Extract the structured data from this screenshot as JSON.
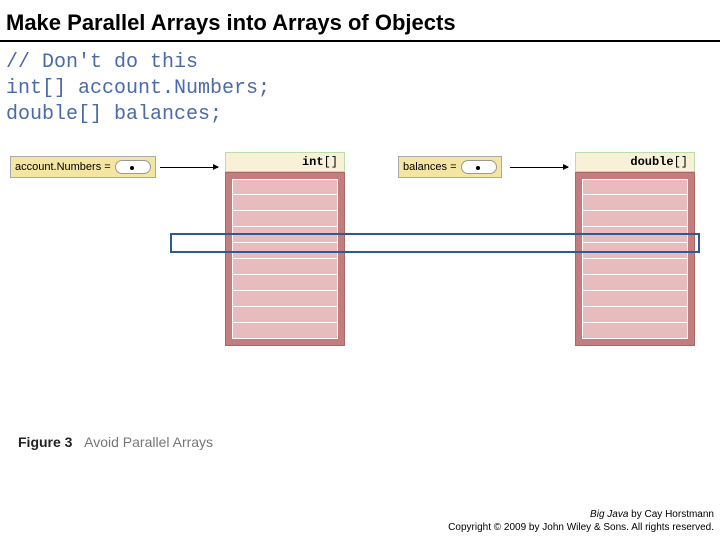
{
  "title": "Make Parallel Arrays into Arrays of Objects",
  "code": {
    "line1": "// Don't do this",
    "line2": "int[] account.Numbers;",
    "line3": "double[] balances;"
  },
  "diagram": {
    "var1": "account.Numbers =",
    "var2": "balances =",
    "type1_kw": "int",
    "type1_suffix": "[]",
    "type2_kw": "double",
    "type2_suffix": "[]"
  },
  "figure": {
    "label": "Figure 3",
    "caption": "Avoid Parallel Arrays"
  },
  "footer": {
    "line1_italic": "Big Java",
    "line1_rest": " by Cay Horstmann",
    "line2": "Copyright © 2009 by John Wiley & Sons.  All rights reserved."
  }
}
